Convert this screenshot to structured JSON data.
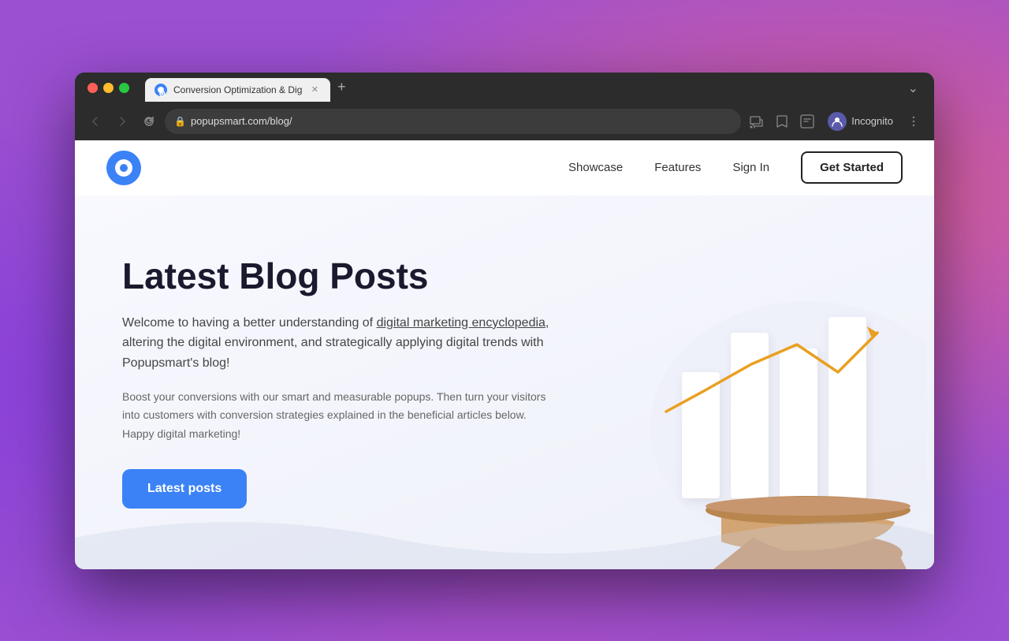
{
  "desktop": {
    "bg_note": "macOS desktop with purple/pink gradient"
  },
  "browser": {
    "tab": {
      "title": "Conversion Optimization & Dig",
      "favicon_note": "popupsmart blue circle logo"
    },
    "new_tab_label": "+",
    "more_label": "⌄",
    "nav": {
      "back_disabled": true,
      "forward_disabled": true,
      "reload_label": "↻"
    },
    "address": {
      "url": "popupsmart.com/blog/",
      "lock_icon": "🔒"
    },
    "toolbar": {
      "cast_icon": "cast",
      "star_icon": "☆",
      "profile_icon": "profile",
      "incognito_label": "Incognito",
      "menu_icon": "⋮"
    }
  },
  "site": {
    "navbar": {
      "logo_alt": "Popupsmart logo",
      "links": [
        {
          "label": "Showcase",
          "href": "#"
        },
        {
          "label": "Features",
          "href": "#"
        },
        {
          "label": "Sign In",
          "href": "#"
        }
      ],
      "cta_label": "Get Started"
    },
    "hero": {
      "title": "Latest Blog Posts",
      "subtitle_plain": "Welcome to having a better understanding of ",
      "subtitle_link": "digital marketing encyclopedia",
      "subtitle_rest": ", altering the digital environment, and strategically applying digital trends with Popupsmart's blog!",
      "description": "Boost your conversions with our smart and measurable popups. Then turn your visitors into customers with conversion strategies explained in the beneficial articles below. Happy digital marketing!",
      "cta_label": "Latest posts"
    }
  }
}
